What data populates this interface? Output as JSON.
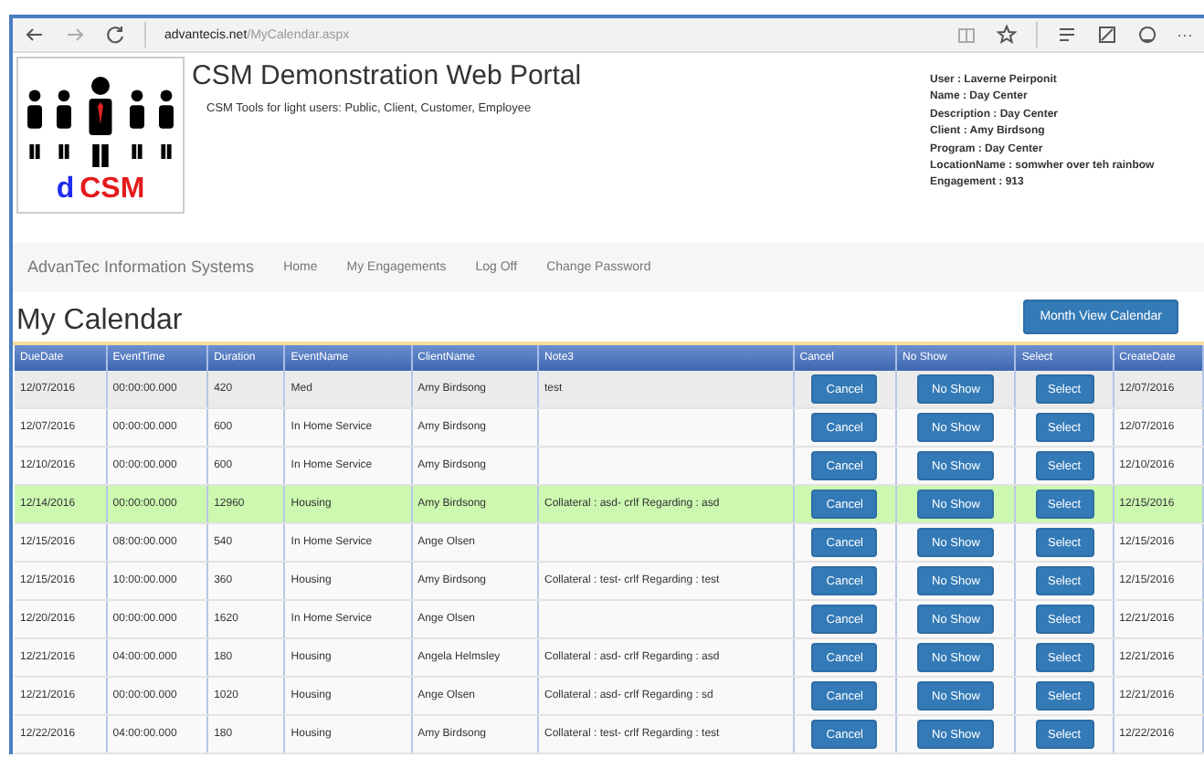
{
  "browser": {
    "url_domain": "advantecis.net",
    "url_path": "/MyCalendar.aspx",
    "more": "···"
  },
  "header": {
    "logo": {
      "mark": "d",
      "name": "CSM"
    },
    "title": "CSM Demonstration Web Portal",
    "subtitle": "CSM Tools for light users: Public, Client, Customer, Employee",
    "info": [
      "User : Laverne Peirponit",
      "Name : Day Center",
      "Description : Day Center",
      "Client : Amy Birdsong",
      "Program : Day Center",
      "LocationName : somwher over teh rainbow",
      "Engagement : 913"
    ]
  },
  "nav": {
    "brand": "AdvanTec Information Systems",
    "links": [
      "Home",
      "My Engagements",
      "Log Off",
      "Change Password"
    ]
  },
  "page_title": "My Calendar",
  "month_button": "Month View Calendar",
  "table": {
    "columns": [
      "DueDate",
      "EventTime",
      "Duration",
      "EventName",
      "ClientName",
      "Note3",
      "Cancel",
      "No Show",
      "Select",
      "CreateDate"
    ],
    "rows": [
      {
        "color": "#ebebeb",
        "cells": [
          "12/07/2016",
          "00:00:00.000",
          "420",
          "Med",
          "Amy Birdsong",
          "test"
        ],
        "buttons": [
          "Cancel",
          "No Show",
          "Select"
        ],
        "created": "12/07/2016"
      },
      {
        "cells": [
          "12/07/2016",
          "00:00:00.000",
          "600",
          "In Home Service",
          "Amy Birdsong",
          ""
        ],
        "buttons": [
          "Cancel",
          "No Show",
          "Select"
        ],
        "created": "12/07/2016"
      },
      {
        "cells": [
          "12/10/2016",
          "00:00:00.000",
          "600",
          "In Home Service",
          "Amy Birdsong",
          ""
        ],
        "buttons": [
          "Cancel",
          "No Show",
          "Select"
        ],
        "created": "12/10/2016"
      },
      {
        "color": "#ccf8b0",
        "cells": [
          "12/14/2016",
          "00:00:00.000",
          "12960",
          "Housing",
          "Amy Birdsong",
          "Collateral : asd- crlf Regarding : asd"
        ],
        "buttons": [
          "Cancel",
          "No Show",
          "Select"
        ],
        "created": "12/15/2016"
      },
      {
        "cells": [
          "12/15/2016",
          "08:00:00.000",
          "540",
          "In Home Service",
          "Ange Olsen",
          ""
        ],
        "buttons": [
          "Cancel",
          "No Show",
          "Select"
        ],
        "created": "12/15/2016"
      },
      {
        "cells": [
          "12/15/2016",
          "10:00:00.000",
          "360",
          "Housing",
          "Amy Birdsong",
          "Collateral : test- crlf Regarding : test"
        ],
        "buttons": [
          "Cancel",
          "No Show",
          "Select"
        ],
        "created": "12/15/2016"
      },
      {
        "cells": [
          "12/20/2016",
          "00:00:00.000",
          "1620",
          "In Home Service",
          "Ange Olsen",
          ""
        ],
        "buttons": [
          "Cancel",
          "No Show",
          "Select"
        ],
        "created": "12/21/2016"
      },
      {
        "cells": [
          "12/21/2016",
          "04:00:00.000",
          "180",
          "Housing",
          "Angela Helmsley",
          "Collateral : asd- crlf Regarding : asd"
        ],
        "buttons": [
          "Cancel",
          "No Show",
          "Select"
        ],
        "created": "12/21/2016"
      },
      {
        "cells": [
          "12/21/2016",
          "00:00:00.000",
          "1020",
          "Housing",
          "Ange Olsen",
          "Collateral : asd- crlf Regarding : sd"
        ],
        "buttons": [
          "Cancel",
          "No Show",
          "Select"
        ],
        "created": "12/21/2016"
      },
      {
        "cells": [
          "12/22/2016",
          "04:00:00.000",
          "180",
          "Housing",
          "Amy Birdsong",
          "Collateral : test- crlf Regarding : test"
        ],
        "buttons": [
          "Cancel",
          "No Show",
          "Select"
        ],
        "created": "12/22/2016"
      }
    ]
  }
}
